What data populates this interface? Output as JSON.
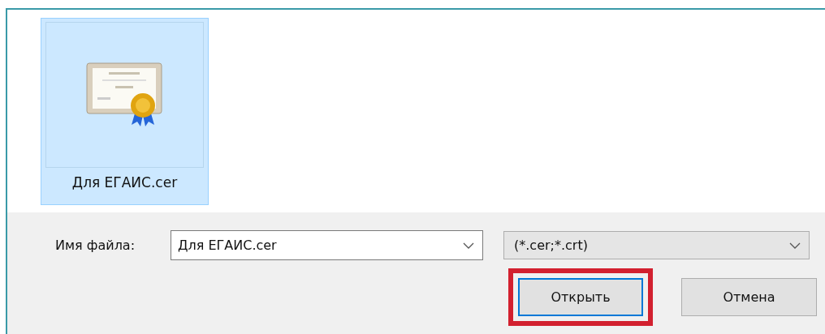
{
  "files": [
    {
      "name": "Для ЕГАИС.cer",
      "selected": true
    }
  ],
  "filename": {
    "label": "Имя файла:",
    "value": "Для ЕГАИС.cer"
  },
  "filter": {
    "value": "(*.cer;*.crt)"
  },
  "buttons": [
    {
      "label": "Открыть",
      "highlighted": true,
      "default": true
    },
    {
      "label": "Отмена",
      "highlighted": false,
      "default": false
    }
  ]
}
